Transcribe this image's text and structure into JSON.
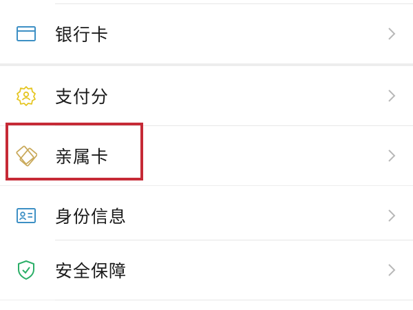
{
  "colors": {
    "background": "#ededed",
    "card": "#ffffff",
    "text": "#1a1a1a",
    "chevron": "#b8b8b8",
    "highlight": "#c62a36",
    "bank_icon": "#3c8fc4",
    "paypoint_icon": "#e5c520",
    "family_card_icon": "#c9a95a",
    "identity_icon": "#3c8fc4",
    "security_icon": "#2aae67"
  },
  "menu": {
    "bank_card": {
      "label": "银行卡",
      "icon": "bank-card-icon"
    },
    "pay_score": {
      "label": "支付分",
      "icon": "pay-score-icon"
    },
    "family_card": {
      "label": "亲属卡",
      "icon": "family-card-icon"
    },
    "identity": {
      "label": "身份信息",
      "icon": "id-card-icon"
    },
    "security": {
      "label": "安全保障",
      "icon": "shield-check-icon"
    }
  }
}
